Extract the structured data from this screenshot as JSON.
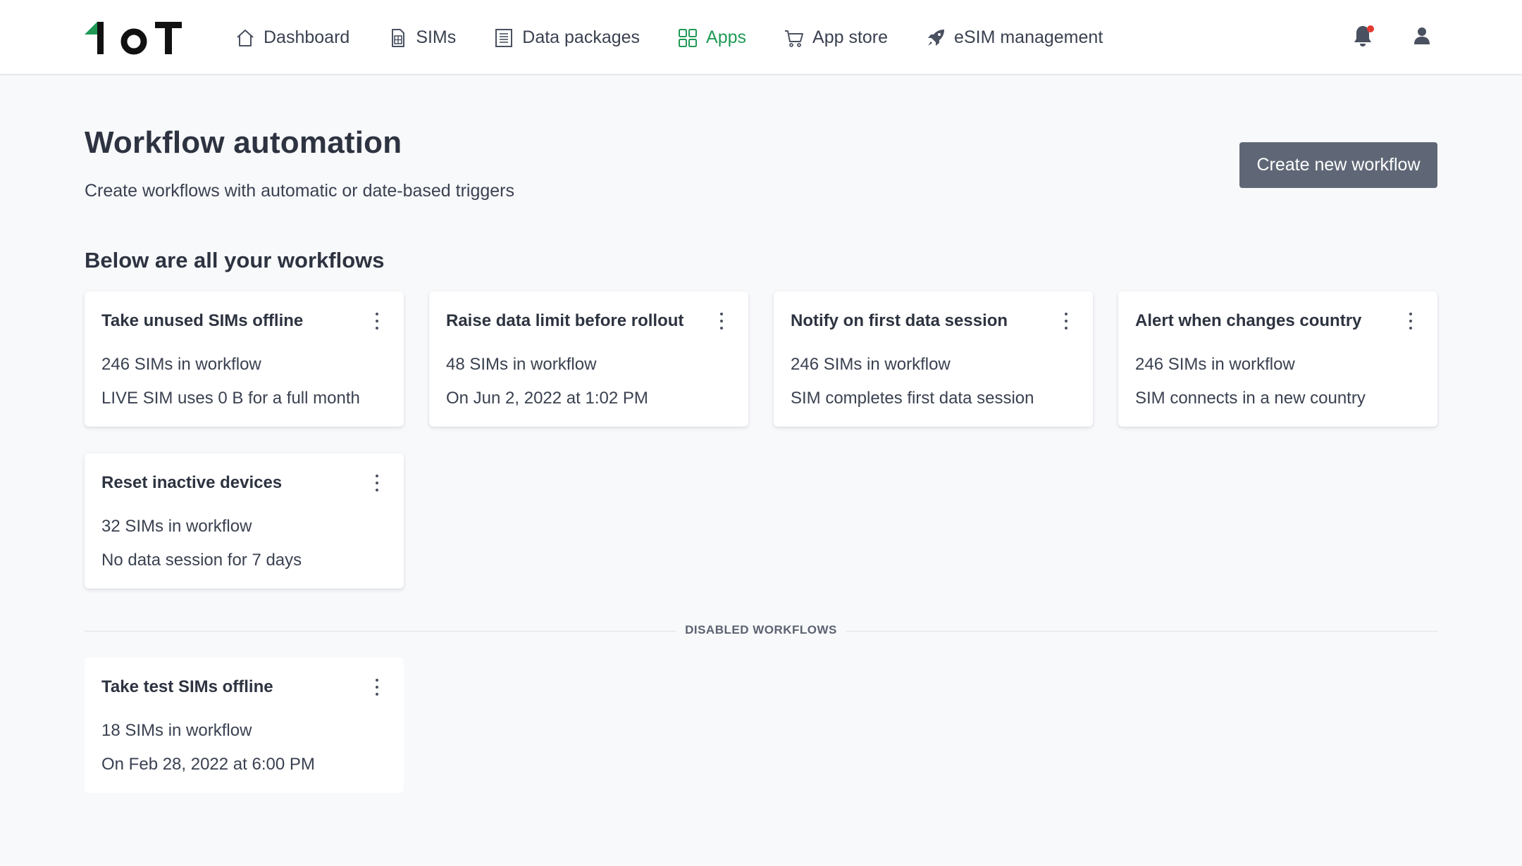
{
  "brand": {
    "logo_text": "1oT",
    "accent": "#1f9a55"
  },
  "nav": {
    "items": [
      {
        "label": "Dashboard",
        "icon": "home-icon",
        "active": false
      },
      {
        "label": "SIMs",
        "icon": "sim-card-icon",
        "active": false
      },
      {
        "label": "Data packages",
        "icon": "document-list-icon",
        "active": false
      },
      {
        "label": "Apps",
        "icon": "grid-icon",
        "active": true
      },
      {
        "label": "App store",
        "icon": "cart-icon",
        "active": false
      },
      {
        "label": "eSIM management",
        "icon": "rocket-icon",
        "active": false
      }
    ],
    "right_icons": [
      "bell-icon",
      "user-icon"
    ]
  },
  "header": {
    "title": "Workflow automation",
    "subtitle": "Create workflows with automatic or date-based triggers",
    "create_button": "Create new workflow"
  },
  "section": {
    "heading": "Below are all your workflows",
    "disabled_label": "DISABLED WORKFLOWS"
  },
  "workflows": [
    {
      "title": "Take unused SIMs offline",
      "count": "246 SIMs in workflow",
      "trigger": "LIVE SIM uses 0 B for a full month"
    },
    {
      "title": "Raise data limit before rollout",
      "count": "48 SIMs in workflow",
      "trigger": "On Jun 2, 2022 at 1:02 PM"
    },
    {
      "title": "Notify on first data session",
      "count": "246 SIMs in workflow",
      "trigger": "SIM completes first data session"
    },
    {
      "title": "Alert when changes country",
      "count": "246 SIMs in workflow",
      "trigger": "SIM connects in a new country"
    },
    {
      "title": "Reset inactive devices",
      "count": "32 SIMs in workflow",
      "trigger": "No data session for 7 days"
    }
  ],
  "disabled_workflows": [
    {
      "title": "Take test SIMs offline",
      "count": "18 SIMs in workflow",
      "trigger": "On Feb 28, 2022 at 6:00 PM"
    }
  ]
}
